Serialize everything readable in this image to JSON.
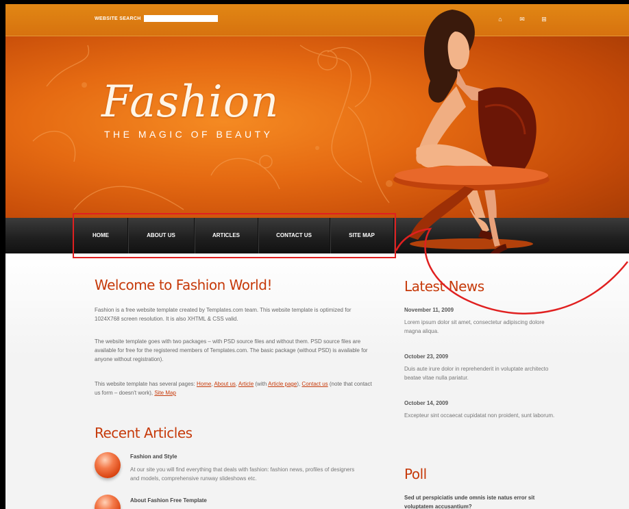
{
  "header": {
    "search_label": "WEBSITE SEARCH",
    "search_value": "",
    "logo": "Fashion",
    "tagline": "THE MAGIC OF BEAUTY",
    "top_icons": [
      "home-icon",
      "mail-icon",
      "sitemap-icon"
    ]
  },
  "nav": {
    "items": [
      "HOME",
      "ABOUT US",
      "ARTICLES",
      "CONTACT US",
      "SITE MAP"
    ]
  },
  "welcome": {
    "title": "Welcome to Fashion World!",
    "p1": "Fashion is a free website template created by Templates.com team. This website template is optimized for 1024X768 screen resolution. It is also XHTML & CSS valid.",
    "p2": "The website template goes with two packages – with PSD source files and without them. PSD source files are available for free for the registered members of Templates.com. The basic package (without PSD) is available for anyone without registration).",
    "p3_start": "This website template has several pages: ",
    "links": [
      "Home",
      "About us",
      "Article",
      "Article page",
      "Contact us",
      "Site Map"
    ],
    "p3_with": " (with ",
    "p3_note": " (note that contact us form – doesn't work), "
  },
  "recent": {
    "title": "Recent Articles",
    "articles": [
      {
        "title": "Fashion and Style",
        "text": "At our site you will find everything that deals with fashion: fashion news, profiles of designers and models, comprehensive runway slideshows etc."
      },
      {
        "title": "About Fashion Free Template",
        "text": ""
      }
    ]
  },
  "news": {
    "title": "Latest News",
    "items": [
      {
        "date": "November 11, 2009",
        "text": "Lorem ipsum dolor sit amet, consectetur adipiscing dolore magna aliqua."
      },
      {
        "date": "October 23, 2009",
        "text": "Duis aute irure dolor in reprehenderit in voluptate architecto beatae vitae nulla pariatur."
      },
      {
        "date": "October 14, 2009",
        "text": "Excepteur sint occaecat cupidatat non proident, sunt laborum."
      }
    ]
  },
  "poll": {
    "title": "Poll",
    "question": "Sed ut perspiciatis unde omnis iste natus error sit voluptatem accusantium?"
  },
  "colors": {
    "accent": "#c63a0a",
    "header_orange": "#e56a12",
    "nav_dark": "#1e1e1e",
    "annotation_red": "#e02020"
  }
}
